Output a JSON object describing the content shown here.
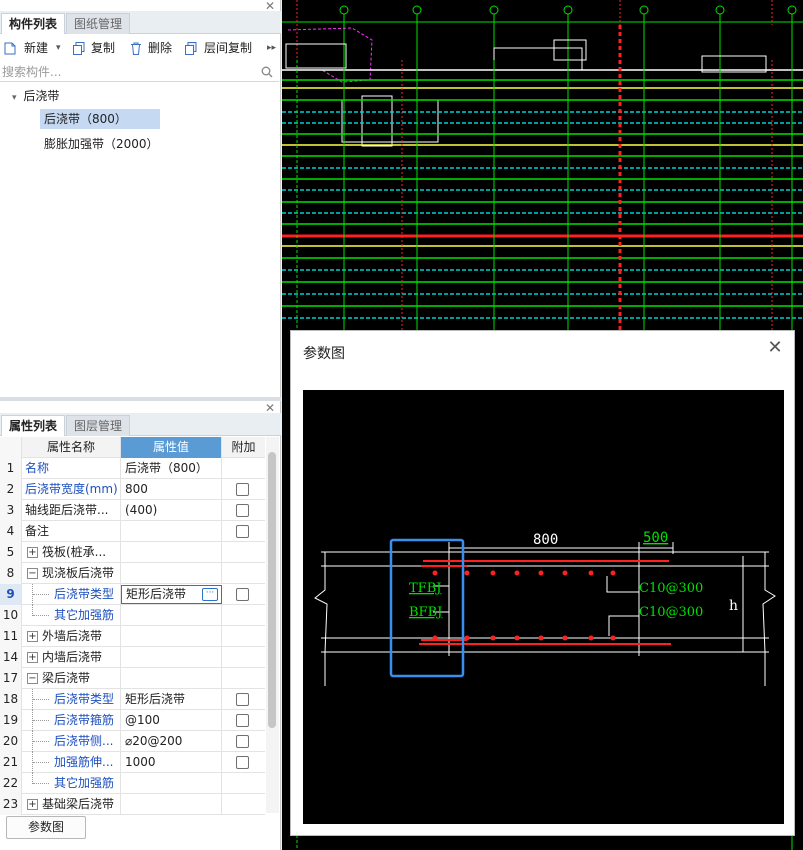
{
  "component_panel": {
    "tabs": [
      "构件列表",
      "图纸管理"
    ],
    "toolbar": {
      "new": "新建",
      "copy": "复制",
      "delete": "删除",
      "floor_copy": "层间复制"
    },
    "search_placeholder": "搜索构件...",
    "tree": {
      "root": "后浇带",
      "children": [
        "后浇带（800）",
        "膨胀加强带（2000）"
      ]
    }
  },
  "properties_panel": {
    "tabs": [
      "属性列表",
      "图层管理"
    ],
    "headers": {
      "name": "属性名称",
      "value": "属性值",
      "extra": "附加"
    },
    "rows": [
      {
        "num": "1",
        "name": "名称",
        "value": "后浇带（800）"
      },
      {
        "num": "2",
        "name": "后浇带宽度(mm)",
        "value": "800"
      },
      {
        "num": "3",
        "name": "轴线距后浇带...",
        "value": "(400)"
      },
      {
        "num": "4",
        "name": "备注",
        "value": ""
      },
      {
        "num": "5",
        "name": "筏板(桩承...",
        "value": ""
      },
      {
        "num": "8",
        "name": "现浇板后浇带",
        "value": ""
      },
      {
        "num": "9",
        "name": "后浇带类型",
        "value": "矩形后浇带"
      },
      {
        "num": "10",
        "name": "其它加强筋",
        "value": ""
      },
      {
        "num": "11",
        "name": "外墙后浇带",
        "value": ""
      },
      {
        "num": "14",
        "name": "内墙后浇带",
        "value": ""
      },
      {
        "num": "17",
        "name": "梁后浇带",
        "value": ""
      },
      {
        "num": "18",
        "name": "后浇带类型",
        "value": "矩形后浇带"
      },
      {
        "num": "19",
        "name": "后浇带箍筋",
        "value": "@100"
      },
      {
        "num": "20",
        "name": "后浇带侧...",
        "value": "⌀20@200"
      },
      {
        "num": "21",
        "name": "加强筋伸...",
        "value": "1000"
      },
      {
        "num": "22",
        "name": "其它加强筋",
        "value": ""
      },
      {
        "num": "23",
        "name": "基础梁后浇带",
        "value": ""
      }
    ],
    "bottom_button": "参数图"
  },
  "param_dialog": {
    "title": "参数图",
    "diagram_labels": {
      "width": "800",
      "extension": "500",
      "top_bar": "TFBJ",
      "bottom_bar": "BFBJ",
      "top_stirrup": "C10@300",
      "bottom_stirrup": "C10@300",
      "height": "h"
    }
  },
  "colors": {
    "accent_blue": "#1d4fbf",
    "header_blue": "#5b9bd5",
    "selection": "#c5daf2",
    "cad_green": "#00e000",
    "cad_red": "#ff2020",
    "cad_yellow": "#ffff40"
  }
}
